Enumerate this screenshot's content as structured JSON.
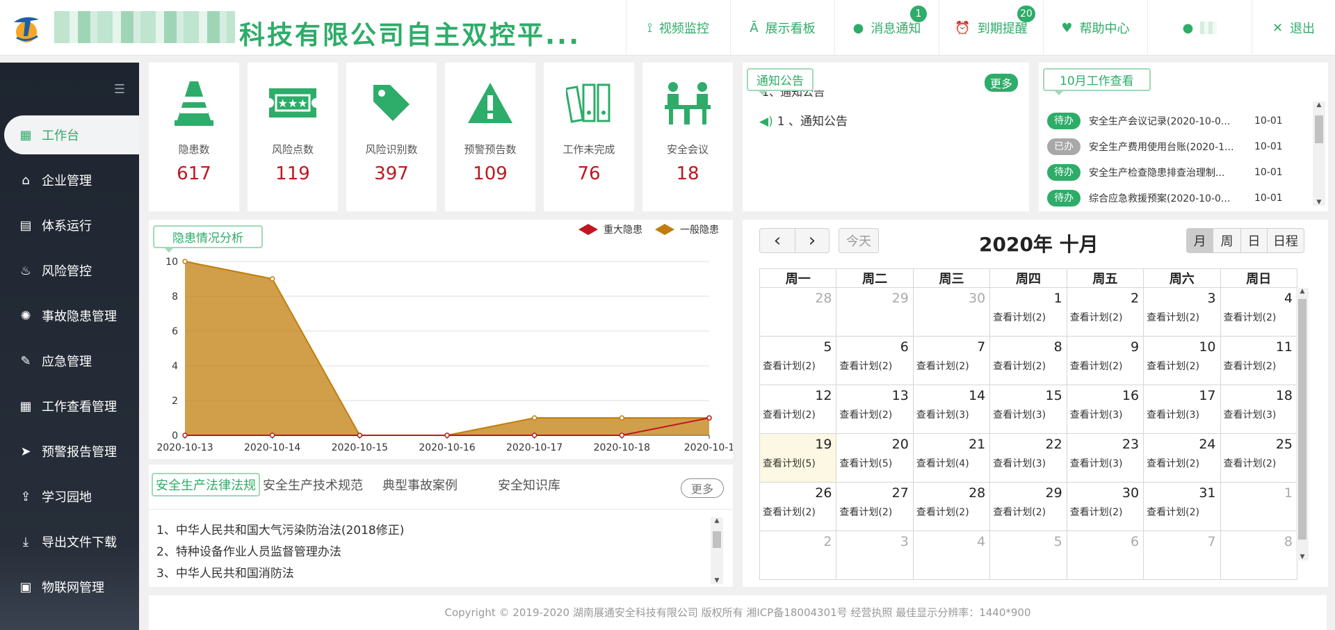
{
  "header": {
    "title": "科技有限公司自主双控平...",
    "nav": [
      {
        "label": "视频监控",
        "icon": "video-camera-icon",
        "name": "nav-video-monitor",
        "badge": ""
      },
      {
        "label": "展示看板",
        "icon": "dashboard-icon",
        "name": "nav-display-board",
        "badge": ""
      },
      {
        "label": "消息通知",
        "icon": "chat-bubble-icon",
        "name": "nav-message-notice",
        "badge": "1"
      },
      {
        "label": "到期提醒",
        "icon": "alarm-clock-icon",
        "name": "nav-expiry-reminder",
        "badge": "20"
      },
      {
        "label": "帮助中心",
        "icon": "heart-icon",
        "name": "nav-help-center",
        "badge": ""
      },
      {
        "label": "",
        "icon": "user-icon",
        "name": "nav-user",
        "badge": ""
      },
      {
        "label": "退出",
        "icon": "close-icon",
        "name": "nav-logout",
        "badge": ""
      }
    ]
  },
  "sidebar": {
    "items": [
      {
        "label": "工作台",
        "icon": "windows-icon",
        "active": true
      },
      {
        "label": "企业管理",
        "icon": "home-icon"
      },
      {
        "label": "体系运行",
        "icon": "document-icon"
      },
      {
        "label": "风险管控",
        "icon": "fire-icon"
      },
      {
        "label": "事故隐患管理",
        "icon": "radiation-icon"
      },
      {
        "label": "应急管理",
        "icon": "edit-form-icon"
      },
      {
        "label": "工作查看管理",
        "icon": "calendar-icon"
      },
      {
        "label": "预警报告管理",
        "icon": "send-icon"
      },
      {
        "label": "学习园地",
        "icon": "upload-person-icon"
      },
      {
        "label": "导出文件下载",
        "icon": "download-icon"
      },
      {
        "label": "物联网管理",
        "icon": "file-icon"
      }
    ]
  },
  "stats": [
    {
      "label": "隐患数",
      "value": "617",
      "icon": "traffic-cone-icon"
    },
    {
      "label": "风险点数",
      "value": "119",
      "icon": "ticket-icon"
    },
    {
      "label": "风险识别数",
      "value": "397",
      "icon": "price-tag-icon"
    },
    {
      "label": "预警预告数",
      "value": "109",
      "icon": "warning-icon"
    },
    {
      "label": "工作未完成",
      "value": "76",
      "icon": "binders-icon"
    },
    {
      "label": "安全会议",
      "value": "18",
      "icon": "meeting-icon"
    }
  ],
  "notice": {
    "title": "通知公告",
    "more": "更多",
    "partial_item": "1、通知公告",
    "items": [
      "1 、通知公告"
    ]
  },
  "work": {
    "title": "10月工作查看",
    "items": [
      {
        "status": "待办",
        "status_color": "#2eac69",
        "text": "安全生产会议记录(2020-10-0...",
        "date": "10-01"
      },
      {
        "status": "已办",
        "status_color": "#a8a8a8",
        "text": "安全生产费用使用台账(2020-1...",
        "date": "10-01"
      },
      {
        "status": "待办",
        "status_color": "#2eac69",
        "text": "安全生产检查隐患排查治理制...",
        "date": "10-01"
      },
      {
        "status": "待办",
        "status_color": "#2eac69",
        "text": "综合应急救援预案(2020-10-0...",
        "date": "10-01"
      }
    ]
  },
  "chart_data": {
    "type": "area",
    "title": "隐患情况分析",
    "x": [
      "2020-10-13",
      "2020-10-14",
      "2020-10-15",
      "2020-10-16",
      "2020-10-17",
      "2020-10-18",
      "2020-10-1"
    ],
    "ylim": [
      0,
      10
    ],
    "yticks": [
      "0",
      "2",
      "4",
      "6",
      "8",
      "10"
    ],
    "grid": true,
    "legend_position": "top-right",
    "series": [
      {
        "name": "重大隐患",
        "color": "#c0171e",
        "values": [
          0,
          0,
          0,
          0,
          0,
          0,
          1
        ]
      },
      {
        "name": "一般隐患",
        "color": "#c27d0e",
        "values": [
          10,
          9,
          0,
          0,
          1,
          1,
          1
        ]
      }
    ]
  },
  "tabs": {
    "items": [
      "安全生产法律法规",
      "安全生产技术规范",
      "典型事故案例",
      "安全知识库"
    ],
    "active_label": "安全生产法律法规",
    "more": "更多"
  },
  "laws": [
    "1、中华人民共和国大气污染防治法(2018修正)",
    "2、特种设备作业人员监督管理办法",
    "3、中华人民共和国消防法"
  ],
  "calendar": {
    "title": "2020年 十月",
    "today_label": "今天",
    "prev": "‹",
    "next": "›",
    "views": [
      "月",
      "周",
      "日",
      "日程"
    ],
    "active_view": "月",
    "weekdays": [
      "周一",
      "周二",
      "周三",
      "周四",
      "周五",
      "周六",
      "周日"
    ],
    "weeks": [
      [
        {
          "d": "28",
          "o": true,
          "e": ""
        },
        {
          "d": "29",
          "o": true,
          "e": ""
        },
        {
          "d": "30",
          "o": true,
          "e": ""
        },
        {
          "d": "1",
          "e": "查看计划(2)"
        },
        {
          "d": "2",
          "e": "查看计划(2)"
        },
        {
          "d": "3",
          "e": "查看计划(2)"
        },
        {
          "d": "4",
          "e": "查看计划(2)"
        }
      ],
      [
        {
          "d": "5",
          "e": "查看计划(2)"
        },
        {
          "d": "6",
          "e": "查看计划(2)"
        },
        {
          "d": "7",
          "e": "查看计划(2)"
        },
        {
          "d": "8",
          "e": "查看计划(2)"
        },
        {
          "d": "9",
          "e": "查看计划(2)"
        },
        {
          "d": "10",
          "e": "查看计划(2)"
        },
        {
          "d": "11",
          "e": "查看计划(2)"
        }
      ],
      [
        {
          "d": "12",
          "e": "查看计划(2)"
        },
        {
          "d": "13",
          "e": "查看计划(2)"
        },
        {
          "d": "14",
          "e": "查看计划(3)"
        },
        {
          "d": "15",
          "e": "查看计划(3)"
        },
        {
          "d": "16",
          "e": "查看计划(3)"
        },
        {
          "d": "17",
          "e": "查看计划(3)"
        },
        {
          "d": "18",
          "e": "查看计划(3)"
        }
      ],
      [
        {
          "d": "19",
          "e": "查看计划(5)",
          "t": true
        },
        {
          "d": "20",
          "e": "查看计划(5)"
        },
        {
          "d": "21",
          "e": "查看计划(4)"
        },
        {
          "d": "22",
          "e": "查看计划(3)"
        },
        {
          "d": "23",
          "e": "查看计划(3)"
        },
        {
          "d": "24",
          "e": "查看计划(2)"
        },
        {
          "d": "25",
          "e": "查看计划(2)"
        }
      ],
      [
        {
          "d": "26",
          "e": "查看计划(2)"
        },
        {
          "d": "27",
          "e": "查看计划(2)"
        },
        {
          "d": "28",
          "e": "查看计划(2)"
        },
        {
          "d": "29",
          "e": "查看计划(2)"
        },
        {
          "d": "30",
          "e": "查看计划(2)"
        },
        {
          "d": "31",
          "e": "查看计划(2)"
        },
        {
          "d": "1",
          "o": true,
          "e": ""
        }
      ],
      [
        {
          "d": "2",
          "o": true,
          "e": ""
        },
        {
          "d": "3",
          "o": true,
          "e": ""
        },
        {
          "d": "4",
          "o": true,
          "e": ""
        },
        {
          "d": "5",
          "o": true,
          "e": ""
        },
        {
          "d": "6",
          "o": true,
          "e": ""
        },
        {
          "d": "7",
          "o": true,
          "e": ""
        },
        {
          "d": "8",
          "o": true,
          "e": ""
        }
      ]
    ]
  },
  "footer": "Copyright © 2019-2020 湖南展通安全科技有限公司 版权所有 湘ICP备18004301号 经营执照   最佳显示分辨率：1440*900"
}
